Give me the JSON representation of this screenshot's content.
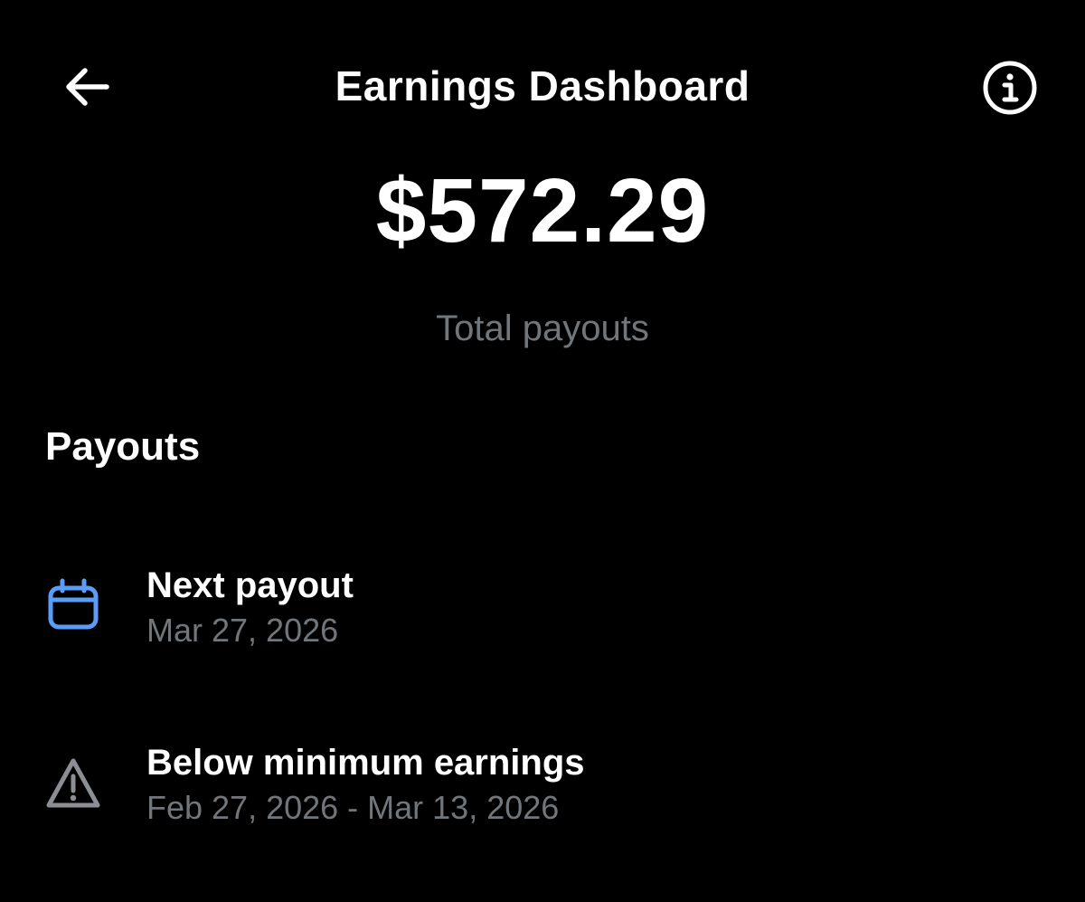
{
  "header": {
    "title": "Earnings Dashboard",
    "back_icon": "arrow-left-icon",
    "info_icon": "info-circle-icon"
  },
  "summary": {
    "total_amount": "$572.29",
    "total_label": "Total payouts"
  },
  "payouts": {
    "section_title": "Payouts",
    "items": [
      {
        "icon": "calendar-icon",
        "icon_color": "#5b9cf6",
        "title": "Next payout",
        "subtitle": "Mar 27, 2026"
      },
      {
        "icon": "warning-triangle-icon",
        "icon_color": "#8b8f94",
        "title": "Below minimum earnings",
        "subtitle": "Feb 27, 2026 - Mar 13, 2026"
      }
    ]
  },
  "colors": {
    "background": "#000000",
    "text_primary": "#ffffff",
    "text_secondary": "#71767b",
    "accent": "#5b9cf6"
  }
}
